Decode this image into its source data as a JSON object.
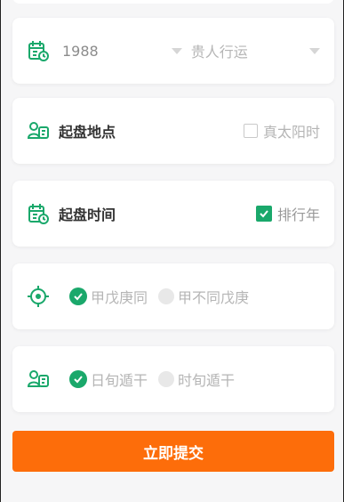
{
  "date_row": {
    "year": "1988",
    "mode": "贵人行运"
  },
  "place_row": {
    "label": "起盘地点",
    "option": "真太阳时"
  },
  "time_row": {
    "label": "起盘时间",
    "option": "排行年"
  },
  "jia_row": {
    "option_a": "甲戊庚同",
    "option_b": "甲不同戊庚"
  },
  "ri_row": {
    "option_a": "日旬遁干",
    "option_b": "时旬遁干"
  },
  "submit_label": "立即提交",
  "colors": {
    "accent_green": "#1aa86b",
    "submit_orange": "#fd6d0a"
  }
}
